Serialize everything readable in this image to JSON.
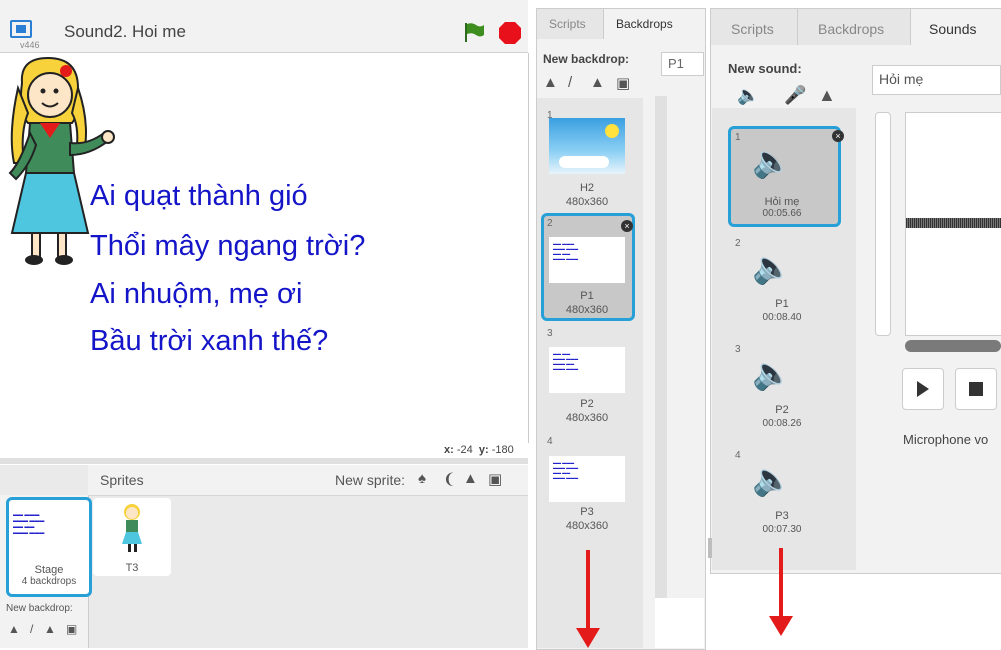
{
  "stage": {
    "version": "v446",
    "title": "Sound2. Hoi me",
    "poem": [
      "Ai quạt thành gió",
      "Thổi mây ngang trời?",
      "Ai nhuộm, mẹ ơi",
      "Bầu trời xanh thế?"
    ],
    "coords": {
      "x_label": "x:",
      "x_value": "-24",
      "y_label": "y:",
      "y_value": "-180"
    }
  },
  "sprites": {
    "label": "Sprites",
    "new_sprite_label": "New sprite:",
    "stage_name": "Stage",
    "stage_info": "4 backdrops",
    "new_backdrop_label": "New backdrop:",
    "items": [
      {
        "name": "T3"
      }
    ]
  },
  "backdrops_panel": {
    "tabs": [
      "Scripts",
      "Backdrops"
    ],
    "new_backdrop_label": "New backdrop:",
    "name_field": "P1",
    "items": [
      {
        "index": "1",
        "name": "H2",
        "size": "480x360"
      },
      {
        "index": "2",
        "name": "P1",
        "size": "480x360"
      },
      {
        "index": "3",
        "name": "P2",
        "size": "480x360"
      },
      {
        "index": "4",
        "name": "P3",
        "size": "480x360"
      }
    ]
  },
  "sounds_panel": {
    "tabs": [
      "Scripts",
      "Backdrops",
      "Sounds"
    ],
    "new_sound_label": "New sound:",
    "name_field": "Hỏi mẹ",
    "microphone_label": "Microphone vo",
    "items": [
      {
        "index": "1",
        "name": "Hỏi mẹ",
        "duration": "00:05.66"
      },
      {
        "index": "2",
        "name": "P1",
        "duration": "00:08.40"
      },
      {
        "index": "3",
        "name": "P2",
        "duration": "00:08.26"
      },
      {
        "index": "4",
        "name": "P3",
        "duration": "00:07.30"
      }
    ]
  },
  "colors": {
    "accent": "#27a0d8",
    "arrow": "#e31b1b",
    "poem": "#1414c8"
  }
}
